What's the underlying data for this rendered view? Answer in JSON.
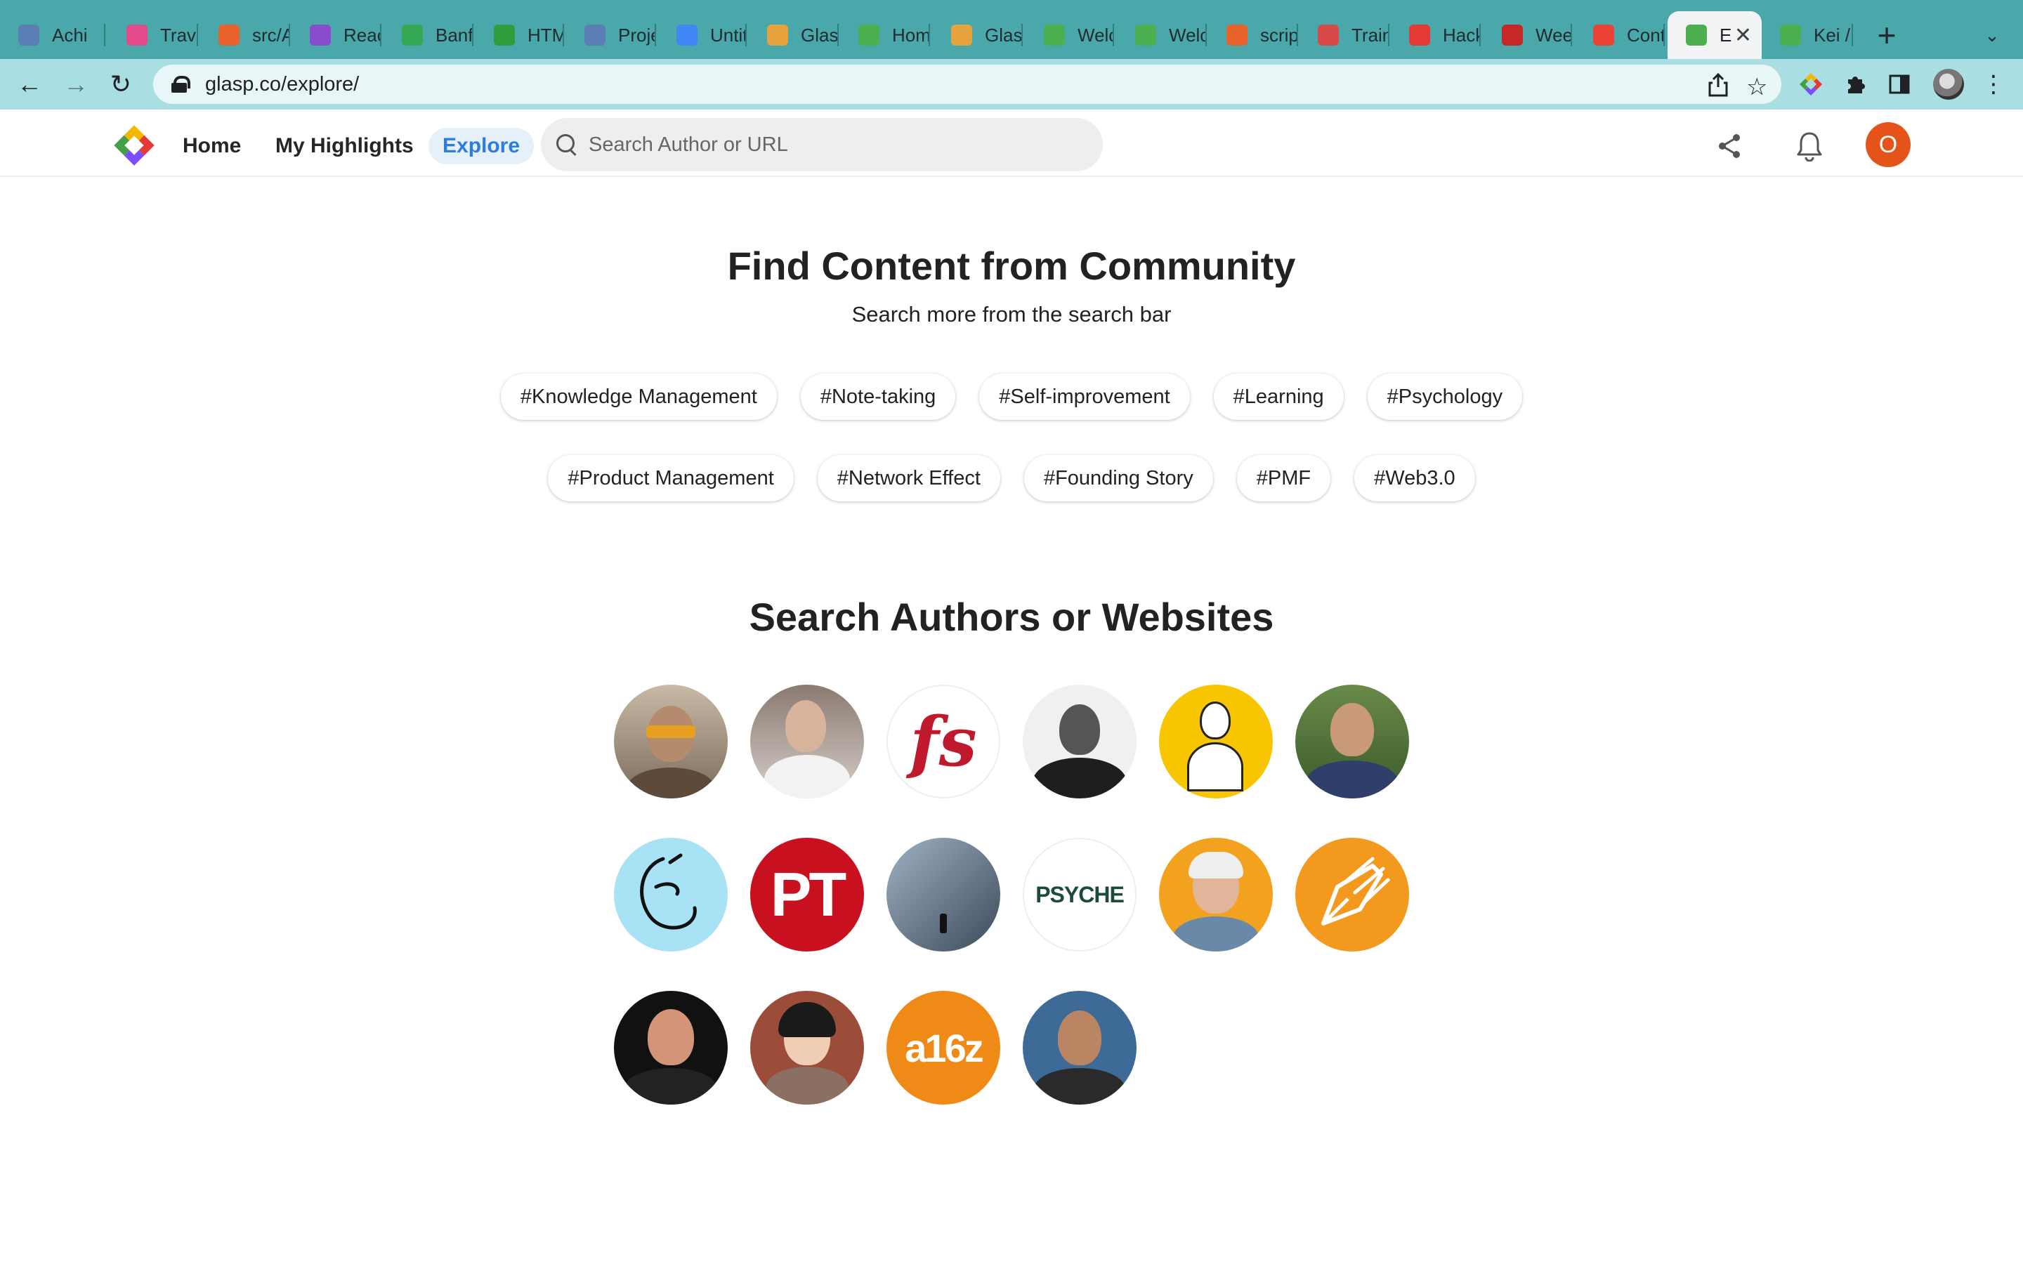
{
  "browser": {
    "tabs": [
      {
        "label": "Achi",
        "favicon_color": "#5b7fb5"
      },
      {
        "label": "Trave",
        "favicon_color": "#e24a8a"
      },
      {
        "label": "src/A",
        "favicon_color": "#e8622c"
      },
      {
        "label": "Reac",
        "favicon_color": "#8a4ccf"
      },
      {
        "label": "Banf",
        "favicon_color": "#34a853"
      },
      {
        "label": "HTM",
        "favicon_color": "#2e9d3a"
      },
      {
        "label": "Proje",
        "favicon_color": "#5b7fb5"
      },
      {
        "label": "Untit",
        "favicon_color": "#4285f4"
      },
      {
        "label": "Glas",
        "favicon_color": "#e6a23c"
      },
      {
        "label": "Hom",
        "favicon_color": "#4caf50"
      },
      {
        "label": "Glas",
        "favicon_color": "#e6a23c"
      },
      {
        "label": "Welc",
        "favicon_color": "#4caf50"
      },
      {
        "label": "Welc",
        "favicon_color": "#4caf50"
      },
      {
        "label": "scrip",
        "favicon_color": "#e8622c"
      },
      {
        "label": "Train",
        "favicon_color": "#d84a4a"
      },
      {
        "label": "Hack",
        "favicon_color": "#e53935"
      },
      {
        "label": "Wee",
        "favicon_color": "#c62828"
      },
      {
        "label": "Cont",
        "favicon_color": "#ea4335"
      },
      {
        "label": "E",
        "favicon_color": "#4caf50"
      },
      {
        "label": "Kei /",
        "favicon_color": "#4caf50"
      }
    ],
    "address": "glasp.co/explore/"
  },
  "header": {
    "nav": [
      "Home",
      "My Highlights",
      "Explore"
    ],
    "search_placeholder": "Search Author or URL",
    "avatar_initial": "O"
  },
  "main": {
    "title": "Find Content from Community",
    "subtitle": "Search more from the search bar",
    "tags_row1": [
      "#Knowledge Management",
      "#Note-taking",
      "#Self-improvement",
      "#Learning",
      "#Psychology"
    ],
    "tags_row2": [
      "#Product Management",
      "#Network Effect",
      "#Founding Story",
      "#PMF",
      "#Web3.0"
    ],
    "authors_title": "Search Authors or Websites",
    "author_logos": {
      "fs": "fs",
      "pt": "PT",
      "psyche": "PSYCHE",
      "a16z": "a16z"
    }
  },
  "colors": {
    "tab_strip": "#4aa8ab",
    "toolbar": "#a9dfe2",
    "accent": "#2a7de1",
    "avatar": "#e4541a"
  }
}
